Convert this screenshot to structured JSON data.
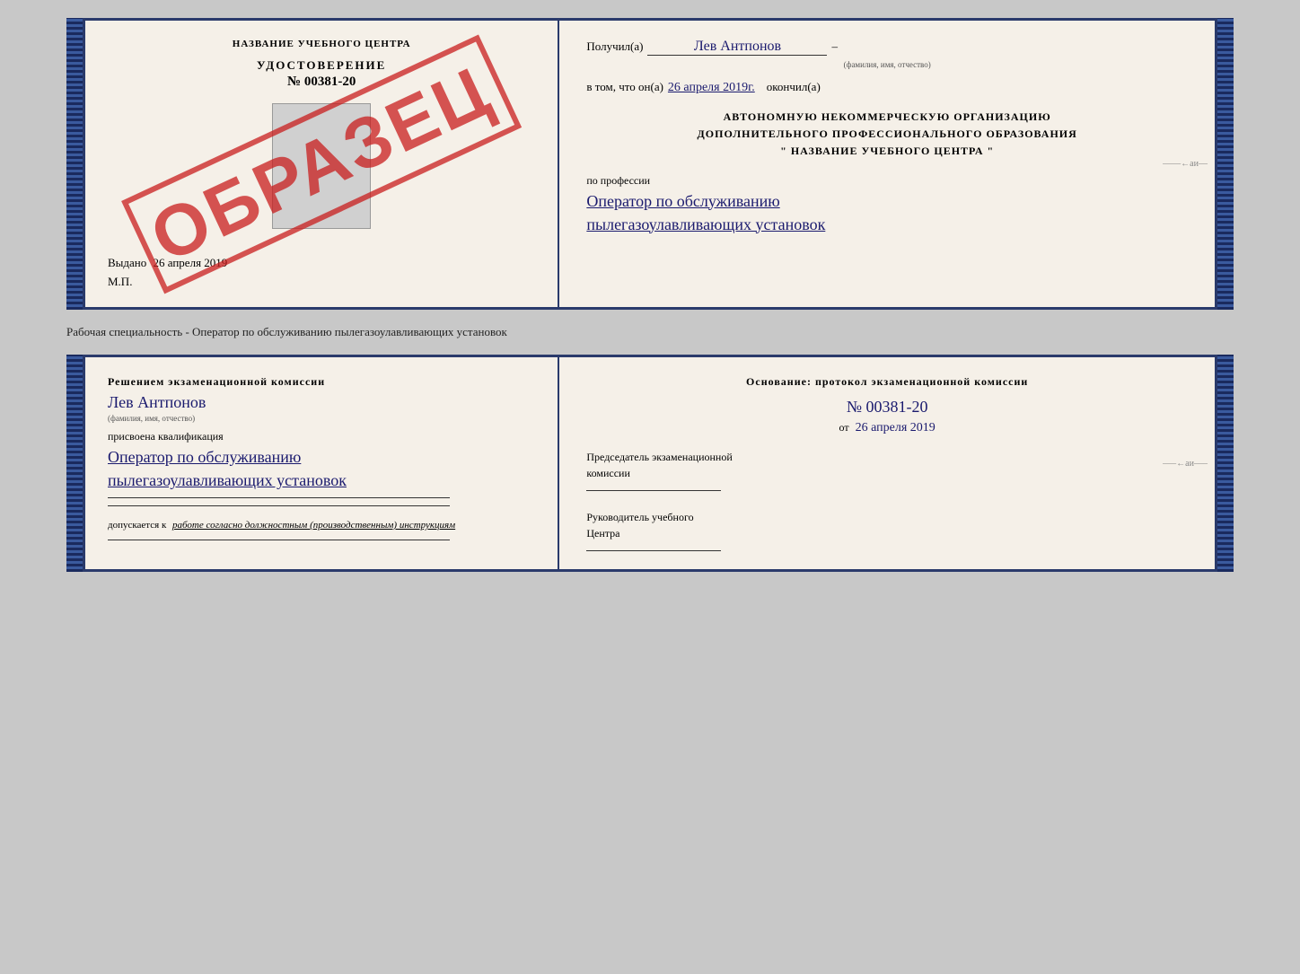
{
  "top_cert": {
    "left": {
      "title": "НАЗВАНИЕ УЧЕБНОГО ЦЕНТРА",
      "stamp": "ОБРАЗЕЦ",
      "udost_title": "УДОСТОВЕРЕНИЕ",
      "udost_number": "№ 00381-20",
      "vydano_label": "Выдано",
      "vydano_date": "26 апреля 2019",
      "mp": "М.П."
    },
    "right": {
      "poluchil_label": "Получил(а)",
      "poluchil_name": "Лев Антпонов",
      "fio_label": "(фамилия, имя, отчество)",
      "vtom_label": "в том, что он(а)",
      "vtom_date": "26 апреля 2019г.",
      "okonchil_label": "окончил(а)",
      "org_line1": "АВТОНОМНУЮ НЕКОММЕРЧЕСКУЮ ОРГАНИЗАЦИЮ",
      "org_line2": "ДОПОЛНИТЕЛЬНОГО ПРОФЕССИОНАЛЬНОГО ОБРАЗОВАНИЯ",
      "org_quote": "\"",
      "org_name": "НАЗВАНИЕ УЧЕБНОГО ЦЕНТРА",
      "org_quote2": "\"",
      "po_professii": "по профессии",
      "profession_line1": "Оператор по обслуживанию",
      "profession_line2": "пылегазоулавливающих установок"
    }
  },
  "between": {
    "text": "Рабочая специальность - Оператор по обслуживанию пылегазоулавливающих установок"
  },
  "bottom_cert": {
    "left": {
      "resheniem": "Решением экзаменационной комиссии",
      "name": "Лев Антпонов",
      "fio_label": "(фамилия, имя, отчество)",
      "prisvoena": "присвоена квалификация",
      "qualification_line1": "Оператор по обслуживанию",
      "qualification_line2": "пылегазоулавливающих установок",
      "dopuskaetsya": "допускается к",
      "dopusk_text": "работе согласно должностным (производственным) инструкциям"
    },
    "right": {
      "osnovanie": "Основание: протокол экзаменационной комиссии",
      "number": "№ 00381-20",
      "ot_label": "от",
      "ot_date": "26 апреля 2019",
      "predsedatel_line1": "Председатель экзаменационной",
      "predsedatel_line2": "комиссии",
      "rukovoditel_line1": "Руководитель учебного",
      "rukovoditel_line2": "Центра"
    }
  }
}
